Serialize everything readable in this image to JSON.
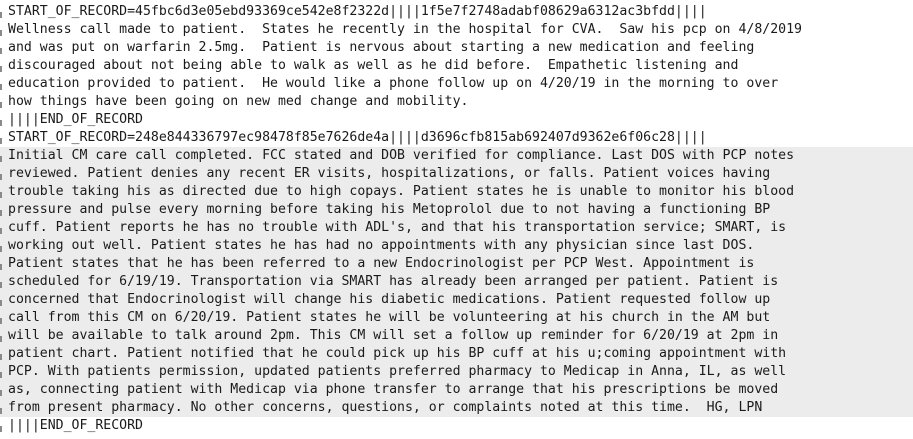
{
  "editor": {
    "lines": [
      "START_OF_RECORD=45fbc6d3e05ebd93369ce542e8f2322d||||1f5e7f2748adabf08629a6312ac3bfdd||||",
      "Wellness call made to patient.  States he recently in the hospital for CVA.  Saw his pcp on 4/8/2019",
      "and was put on warfarin 2.5mg.  Patient is nervous about starting a new medication and feeling",
      "discouraged about not being able to walk as well as he did before.  Empathetic listening and",
      "education provided to patient.  He would like a phone follow up on 4/20/19 in the morning to over",
      "how things have been going on new med change and mobility.",
      "||||END_OF_RECORD",
      "START_OF_RECORD=248e844336797ec98478f85e7626de4a||||d3696cfb815ab692407d9362e6f06c28||||",
      "Initial CM care call completed. FCC stated and DOB verified for compliance. Last DOS with PCP notes",
      "reviewed. Patient denies any recent ER visits, hospitalizations, or falls. Patient voices having",
      "trouble taking his as directed due to high copays. Patient states he is unable to monitor his blood",
      "pressure and pulse every morning before taking his Metoprolol due to not having a functioning BP",
      "cuff. Patient reports he has no trouble with ADL's, and that his transportation service; SMART, is",
      "working out well. Patient states he has had no appointments with any physician since last DOS.",
      "Patient states that he has been referred to a new Endocrinologist per PCP West. Appointment is",
      "scheduled for 6/19/19. Transportation via SMART has already been arranged per patient. Patient is",
      "concerned that Endocrinologist will change his diabetic medications. Patient requested follow up",
      "call from this CM on 6/20/19. Patient states he will be volunteering at his church in the AM but",
      "will be available to talk around 2pm. This CM will set a follow up reminder for 6/20/19 at 2pm in",
      "patient chart. Patient notified that he could pick up his BP cuff at his u;coming appointment with",
      "PCP. With patients permission, updated patients preferred pharmacy to Medicap in Anna, IL, as well",
      "as, connecting patient with Medicap via phone transfer to arrange that his prescriptions be moved",
      "from present pharmacy. No other concerns, questions, or complaints noted at this time.  HG, LPN",
      "||||END_OF_RECORD"
    ],
    "highlighted_from": 8,
    "highlighted_to": 22
  }
}
